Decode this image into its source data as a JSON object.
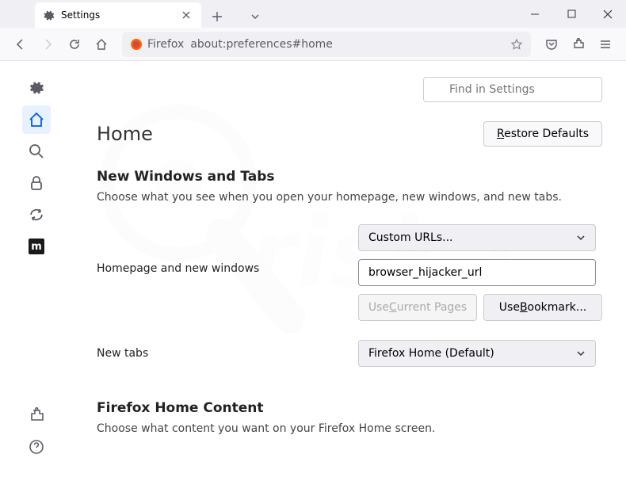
{
  "tab": {
    "title": "Settings"
  },
  "url": {
    "identity": "Firefox",
    "address": "about:preferences#home"
  },
  "search": {
    "placeholder": "Find in Settings"
  },
  "header": {
    "title": "Home",
    "restore": "Restore Defaults"
  },
  "section1": {
    "heading": "New Windows and Tabs",
    "desc": "Choose what you see when you open your homepage, new windows, and new tabs.",
    "homepage_label": "Homepage and new windows",
    "homepage_select": "Custom URLs...",
    "homepage_value": "browser_hijacker_url",
    "use_current": "Use Current Pages",
    "use_bookmark": "Use Bookmark...",
    "newtabs_label": "New tabs",
    "newtabs_select": "Firefox Home (Default)"
  },
  "section2": {
    "heading": "Firefox Home Content",
    "desc": "Choose what content you want on your Firefox Home screen."
  }
}
